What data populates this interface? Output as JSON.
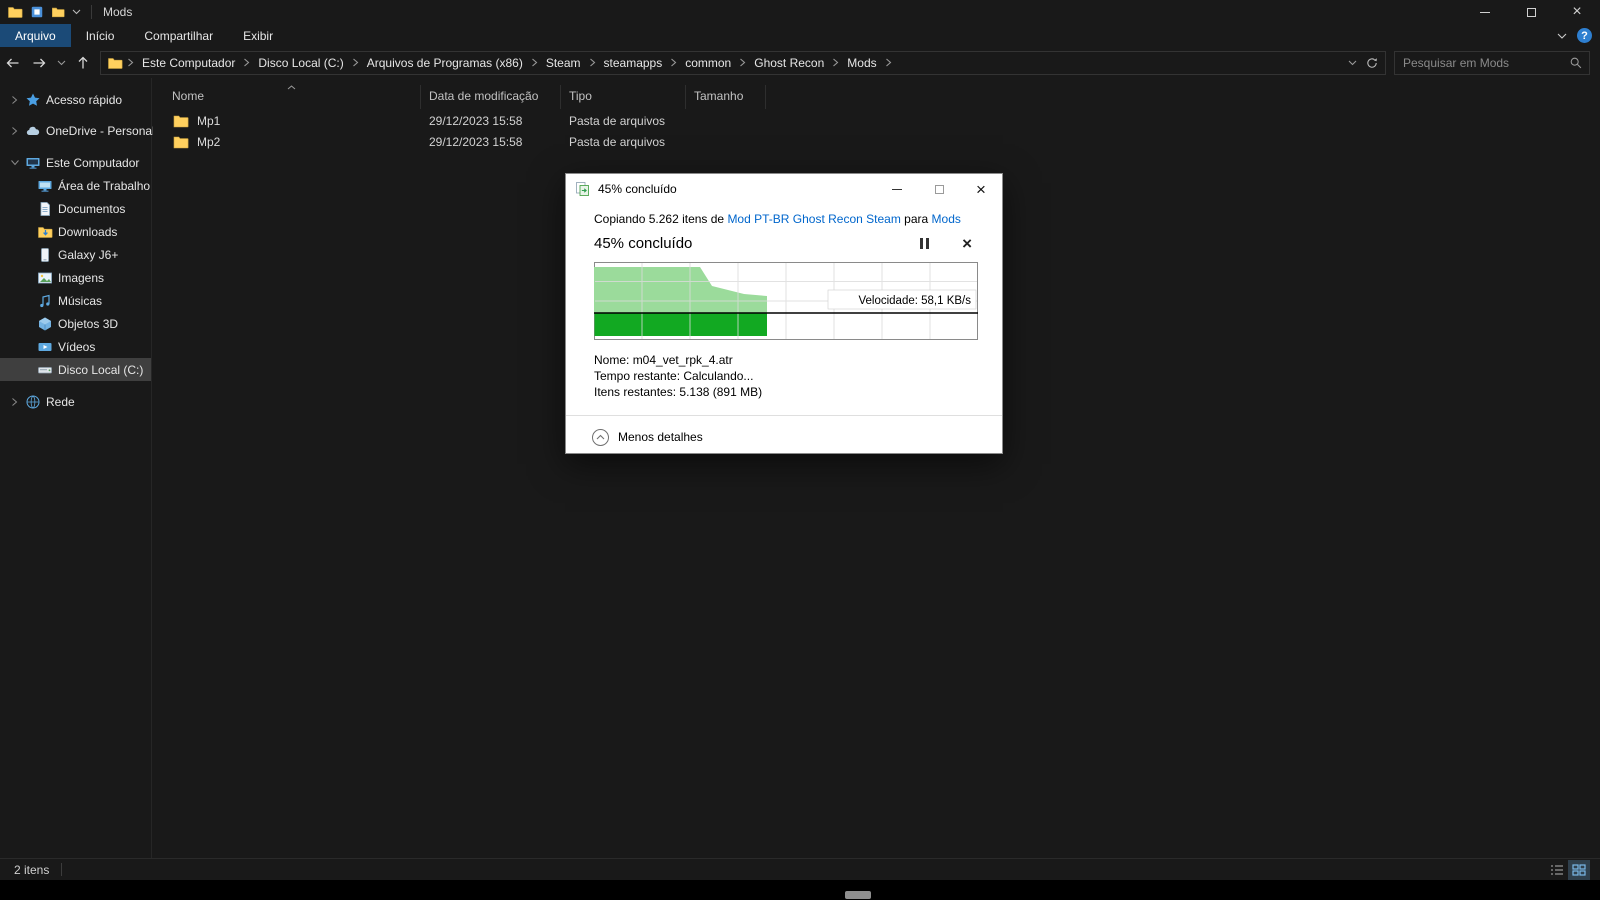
{
  "titlebar": {
    "title": "Mods"
  },
  "ribbon": {
    "tabs": [
      "Arquivo",
      "Início",
      "Compartilhar",
      "Exibir"
    ]
  },
  "address": {
    "breadcrumb": [
      "Este Computador",
      "Disco Local (C:)",
      "Arquivos de Programas (x86)",
      "Steam",
      "steamapps",
      "common",
      "Ghost Recon",
      "Mods"
    ],
    "search_placeholder": "Pesquisar em Mods"
  },
  "sidebar": {
    "items": [
      {
        "label": "Acesso rápido"
      },
      {
        "label": "OneDrive - Personal"
      },
      {
        "label": "Este Computador"
      },
      {
        "label": "Área de Trabalho"
      },
      {
        "label": "Documentos"
      },
      {
        "label": "Downloads"
      },
      {
        "label": "Galaxy J6+"
      },
      {
        "label": "Imagens"
      },
      {
        "label": "Músicas"
      },
      {
        "label": "Objetos 3D"
      },
      {
        "label": "Vídeos"
      },
      {
        "label": "Disco Local (C:)"
      },
      {
        "label": "Rede"
      }
    ]
  },
  "files": {
    "columns": [
      "Nome",
      "Data de modificação",
      "Tipo",
      "Tamanho"
    ],
    "rows": [
      {
        "name": "Mp1",
        "modified": "29/12/2023 15:58",
        "type": "Pasta de arquivos",
        "size": ""
      },
      {
        "name": "Mp2",
        "modified": "29/12/2023 15:58",
        "type": "Pasta de arquivos",
        "size": ""
      }
    ]
  },
  "dialog": {
    "title": "45% concluído",
    "copy_prefix": "Copiando 5.262 itens de ",
    "copy_source": "Mod PT-BR Ghost Recon Steam",
    "copy_middle": " para ",
    "copy_dest": "Mods",
    "percent": "45% concluído",
    "speed": "Velocidade: 58,1 KB/s",
    "name_label": "Nome:",
    "name_value": "m04_vet_rpk_4.atr",
    "time_label": "Tempo restante:",
    "time_value": "Calculando...",
    "items_label": "Itens restantes:",
    "items_value": "5.138 (891 MB)",
    "less_details": "Menos detalhes"
  },
  "statusbar": {
    "count": "2 itens"
  },
  "icons": {
    "app-icon": "yellow-folder",
    "search-icon": "magnifier",
    "back-icon": "arrow-left",
    "forward-icon": "arrow-right",
    "up-icon": "arrow-up",
    "refresh-icon": "circular-arrow",
    "help-icon": "question-circle",
    "quick-access-icon": "star",
    "onedrive-icon": "cloud",
    "computer-icon": "monitor",
    "copy-progress-icon": "copy-files-green-arrow",
    "pause-icon": "double-bar",
    "cancel-icon": "cross",
    "less-details-icon": "chevron-up-circle"
  }
}
